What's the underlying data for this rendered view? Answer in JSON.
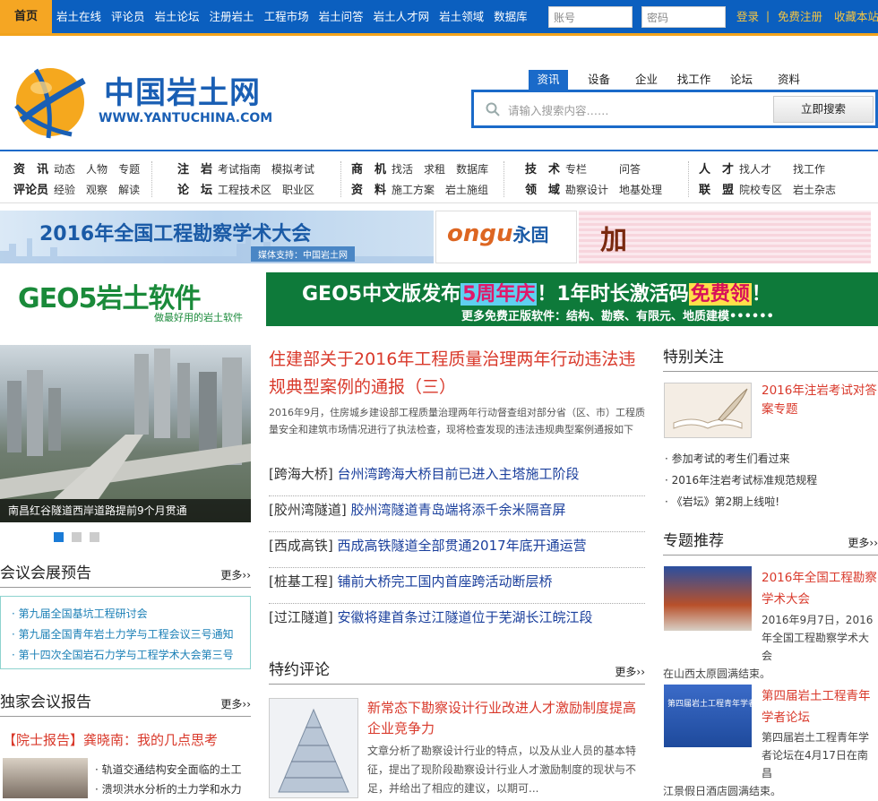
{
  "nav": {
    "home": "首页",
    "links": [
      "岩土在线",
      "评论员",
      "岩土论坛",
      "注册岩土",
      "工程市场",
      "岩土问答",
      "岩土人才网",
      "岩土领域",
      "数据库"
    ],
    "account_placeholder": "账号",
    "password_placeholder": "密码",
    "login": "登录",
    "separator": "|",
    "register": "免费注册",
    "favorite": "收藏本站"
  },
  "logo": {
    "cn": "中国岩土网",
    "en": "WWW.YANTUCHINA.COM"
  },
  "search": {
    "tabs": [
      "资讯",
      "设备",
      "企业",
      "找工作",
      "论坛",
      "资料"
    ],
    "placeholder": "请输入搜索内容……",
    "button": "立即搜索"
  },
  "categories": [
    {
      "rows": [
        {
          "head": "资　讯",
          "items": [
            "动态",
            "人物",
            "专题"
          ]
        },
        {
          "head": "评论员",
          "items": [
            "经验",
            "观察",
            "解读"
          ]
        }
      ]
    },
    {
      "rows": [
        {
          "head": "注　岩",
          "items": [
            "考试指南",
            "模拟考试"
          ]
        },
        {
          "head": "论　坛",
          "items": [
            "工程技术区",
            "职业区"
          ]
        }
      ]
    },
    {
      "rows": [
        {
          "head": "商　机",
          "items": [
            "找活",
            "求租",
            "数据库"
          ]
        },
        {
          "head": "资　料",
          "items": [
            "施工方案",
            "岩土施组"
          ]
        }
      ]
    },
    {
      "rows": [
        {
          "head": "技　术",
          "items": [
            "专栏",
            "问答"
          ]
        },
        {
          "head": "领　域",
          "items": [
            "勘察设计",
            "地基处理"
          ]
        }
      ]
    },
    {
      "rows": [
        {
          "head": "人　才",
          "items": [
            "找人才",
            "找工作"
          ]
        },
        {
          "head": "联　盟",
          "items": [
            "院校专区",
            "岩土杂志"
          ]
        }
      ]
    }
  ],
  "banners": {
    "b1_title": "2016年全国工程勘察学术大会",
    "b1_sub": "媒体支持：中国岩土网",
    "b2_title": "ongu",
    "b2_brand": "永固",
    "b3_title": "加",
    "geo_left": "GEO5岩土软件",
    "geo_left_sub": "做最好用的岩土软件",
    "geo_right_a": "GEO5中文版发布",
    "geo_right_b": "5周年庆",
    "geo_right_c": "！1年时长激活码",
    "geo_right_d": "免费领",
    "geo_right_e": "！",
    "geo_right_sub": "更多免费正版软件：结构、勘察、有限元、地质建模••••••"
  },
  "slider": {
    "caption": "南昌红谷隧道西岸道路提前9个月贯通",
    "dots": 3,
    "active": 0
  },
  "conference": {
    "title": "会议会展预告",
    "more": "更多",
    "items": [
      "第九届全国基坑工程研讨会",
      "第九届全国青年岩土力学与工程会议三号通知",
      "第十四次全国岩石力学与工程学术大会第三号"
    ]
  },
  "report": {
    "title": "独家会议报告",
    "more": "更多",
    "headline": "【院士报告】龚晓南：我的几点思考",
    "items": [
      "轨道交通结构安全面临的土工",
      "溃坝洪水分析的土力学和水力"
    ]
  },
  "main": {
    "headline": "住建部关于2016年工程质量治理两年行动违法违规典型案例的通报（三）",
    "summary": "2016年9月，住房城乡建设部工程质量治理两年行动督查组对部分省（区、市）工程质量安全和建筑市场情况进行了执法检查，现将检查发现的违法违规典型案例通报如下",
    "news": [
      {
        "tag": "[跨海大桥]",
        "text": "台州湾跨海大桥目前已进入主塔施工阶段"
      },
      {
        "tag": "[胶州湾隧道]",
        "text": "胶州湾隧道青岛端将添千余米隔音屏"
      },
      {
        "tag": "[西成高铁]",
        "text": "西成高铁隧道全部贯通2017年底开通运营"
      },
      {
        "tag": "[桩基工程]",
        "text": "铺前大桥完工国内首座跨活动断层桥"
      },
      {
        "tag": "[过江隧道]",
        "text": "安徽将建首条过江隧道位于芜湖长江皖江段"
      }
    ]
  },
  "review": {
    "title": "特约评论",
    "more": "更多",
    "headline": "新常态下勘察设计行业改进人才激励制度提高企业竞争力",
    "text": "文章分析了勘察设计行业的特点，以及从业人员的基本特征，提出了现阶段勘察设计行业人才激励制度的现状与不足，并给出了相应的建议，以期可..."
  },
  "special": {
    "title": "特别关注",
    "headline": "2016年注岩考试对答案专题",
    "items": [
      "参加考试的考生们看过来",
      "2016年注岩考试标准规范规程",
      "《岩坛》第2期上线啦!"
    ]
  },
  "topics": {
    "title": "专题推荐",
    "more": "更多",
    "t1_title": "2016年全国工程勘察学术大会",
    "t1_text_a": "2016年9月7日，2016年全国工程勘察学术大会",
    "t1_text_b": "在山西太原圆满结束。",
    "t2_img": "第四届岩土工程青年学者论坛",
    "t2_title": "第四届岩土工程青年学者论坛",
    "t2_text_a": "第四届岩土工程青年学者论坛在4月17日在南昌",
    "t2_text_b": "江景假日酒店圆满结束。"
  },
  "colors": {
    "brand_blue": "#0b5fbf",
    "accent_orange": "#f5a623",
    "headline_red": "#d9392b",
    "link_blue": "#1a3f9c"
  }
}
